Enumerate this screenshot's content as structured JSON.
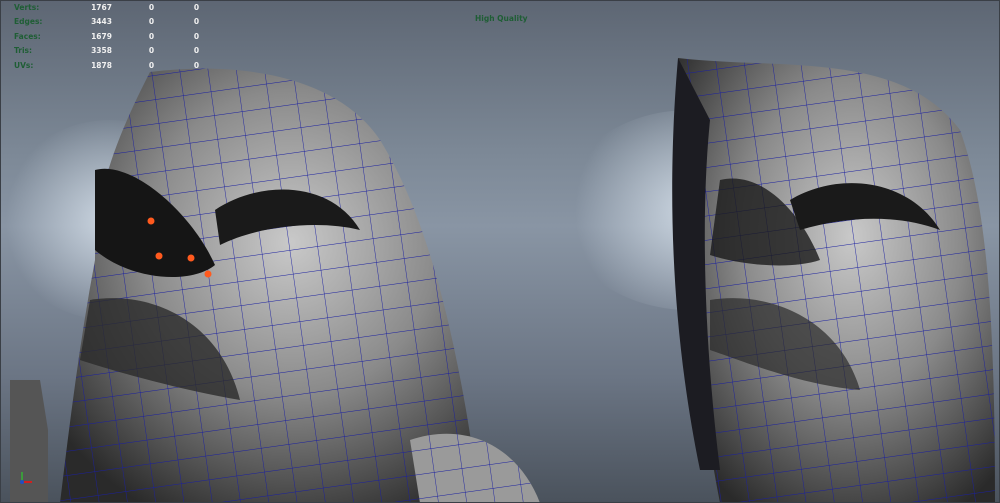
{
  "hud": {
    "rows": [
      {
        "label": "Verts:",
        "value": "1767",
        "a": "0",
        "b": "0"
      },
      {
        "label": "Edges:",
        "value": "3443",
        "a": "0",
        "b": "0"
      },
      {
        "label": "Faces:",
        "value": "1679",
        "a": "0",
        "b": "0"
      },
      {
        "label": "Tris:",
        "value": "3358",
        "a": "0",
        "b": "0"
      },
      {
        "label": "UVs:",
        "value": "1878",
        "a": "0",
        "b": "0"
      }
    ],
    "quality": "High Quality"
  },
  "colors": {
    "wire": "#1a1fa0",
    "vertex": "#ff5a1e",
    "hudLabel": "#1f5e35"
  }
}
